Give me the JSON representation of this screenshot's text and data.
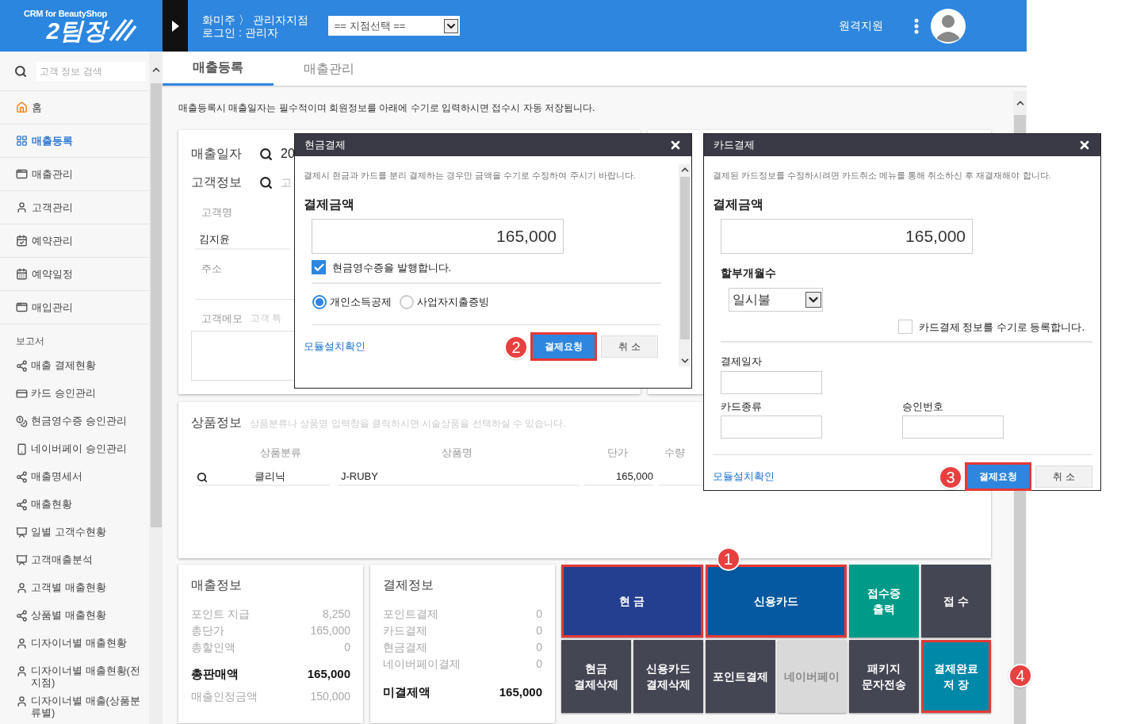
{
  "header": {
    "logo_small": "CRM for BeautyShop",
    "logo_big": "2팀장",
    "breadcrumb": "화미주 〉 관리자지점",
    "login": "로그인 : 관리자",
    "branch_select": "== 지점선택 ==",
    "remote_support": "원격지원"
  },
  "sidebar": {
    "search_placeholder": "고객 정보 검색",
    "items": [
      {
        "label": "홈",
        "kind": "home",
        "selected": false
      },
      {
        "label": "매출등록",
        "kind": "grid",
        "selected": true
      },
      {
        "label": "매출관리",
        "kind": "window",
        "selected": false
      },
      {
        "label": "고객관리",
        "kind": "person",
        "selected": false
      },
      {
        "label": "예약관리",
        "kind": "booking",
        "selected": false
      },
      {
        "label": "예약일정",
        "kind": "calendar",
        "selected": false
      },
      {
        "label": "매입관리",
        "kind": "window",
        "selected": false
      }
    ],
    "section": "보고서",
    "reports": [
      {
        "label": "매출 결제현황",
        "kind": "share"
      },
      {
        "label": "카드 승인관리",
        "kind": "card"
      },
      {
        "label": "현금영수증 승인관리",
        "kind": "cash"
      },
      {
        "label": "네이버페이 승인관리",
        "kind": "phone"
      },
      {
        "label": "매출명세서",
        "kind": "share"
      },
      {
        "label": "매출현황",
        "kind": "share"
      },
      {
        "label": "일별 고객수현황",
        "kind": "chart"
      },
      {
        "label": "고객매출분석",
        "kind": "chart"
      },
      {
        "label": "고객별 매출현황",
        "kind": "person"
      },
      {
        "label": "상품별 매출현황",
        "kind": "share"
      },
      {
        "label": "디자이너별 매출현황",
        "kind": "person"
      },
      {
        "label": "디자이너별 매출현황(전지점)",
        "kind": "person"
      },
      {
        "label": "디자이너별 매출(상품분류별)",
        "kind": "person"
      }
    ]
  },
  "tabs": [
    {
      "label": "매출등록",
      "selected": true
    },
    {
      "label": "매출관리",
      "selected": false
    }
  ],
  "notice": "매출등록시 매출일자는 필수적이며 회원정보를 아래에 수기로 입력하시면 접수시 자동 저장됩니다.",
  "sale_form": {
    "date_label": "매출일자",
    "date_value": "20",
    "customer_label": "고객정보",
    "customer_placeholder": "고",
    "name_label": "고객명",
    "name_value": "김지윤",
    "address_label": "주소",
    "memo_label": "고객메모",
    "memo_placeholder": "고객 특"
  },
  "product": {
    "title": "상품정보",
    "hint": "상품분류나 상품명 입력창을 클릭하시면 시술상품을 선택하실 수 있습니다.",
    "columns": [
      "상품분류",
      "상품명",
      "단가",
      "수량"
    ],
    "row": [
      "클리닉",
      "J-RUBY",
      "165,000"
    ]
  },
  "sales_info": {
    "title": "매출정보",
    "rows": [
      {
        "label": "포인트 지급",
        "value": "8,250"
      },
      {
        "label": "총단가",
        "value": "165,000"
      },
      {
        "label": "총할인액",
        "value": "0"
      }
    ],
    "total": {
      "label": "총판매액",
      "value": "165,000"
    },
    "approved": {
      "label": "매출인정금액",
      "value": "150,000"
    }
  },
  "payment_info": {
    "title": "결제정보",
    "rows": [
      {
        "label": "포인트결제",
        "value": "0"
      },
      {
        "label": "카드결제",
        "value": "0"
      },
      {
        "label": "현금결제",
        "value": "0"
      },
      {
        "label": "네이버페이결제",
        "value": "0"
      }
    ],
    "total": {
      "label": "미결제액",
      "value": "165,000"
    }
  },
  "pay_buttons": [
    {
      "kind": "main",
      "lines": [
        "현 금"
      ],
      "color": "#243f8f",
      "highlighted": true,
      "disabled": false,
      "badge": "1"
    },
    {
      "kind": "main",
      "lines": [
        "신용카드"
      ],
      "color": "#0559a0",
      "highlighted": true,
      "disabled": false
    },
    {
      "kind": "tile",
      "lines": [
        "접수증",
        "출력"
      ],
      "color": "#009b88",
      "highlighted": false,
      "disabled": false
    },
    {
      "kind": "tile",
      "lines": [
        "접 수"
      ],
      "color": "#454654",
      "highlighted": false,
      "disabled": false
    },
    {
      "kind": "tile",
      "lines": [
        "현금",
        "결제삭제"
      ],
      "color": "#454654",
      "highlighted": false,
      "disabled": false
    },
    {
      "kind": "tile",
      "lines": [
        "신용카드",
        "결제삭제"
      ],
      "color": "#454654",
      "highlighted": false,
      "disabled": false
    },
    {
      "kind": "tile",
      "lines": [
        "포인트결제"
      ],
      "color": "#454654",
      "highlighted": false,
      "disabled": false
    },
    {
      "kind": "tile",
      "lines": [
        "네이버페이"
      ],
      "color": "#d9d9d9",
      "highlighted": false,
      "disabled": true
    },
    {
      "kind": "tile",
      "lines": [
        "패키지",
        "문자전송"
      ],
      "color": "#454654",
      "highlighted": false,
      "disabled": false
    },
    {
      "kind": "tile",
      "lines": [
        "결제완료",
        "저 장"
      ],
      "color": "#0088a8",
      "highlighted": true,
      "disabled": false,
      "badge": "4"
    }
  ],
  "cash_dialog": {
    "title": "현금결제",
    "note": "결제시 현금과 카드를 분리 결제하는 경우만 금액을 수기로 수정하여 주시기 바랍니다.",
    "amount_label": "결제금액",
    "amount": "165,000",
    "receipt": {
      "label": "현금영수증을 발행합니다.",
      "checked": true
    },
    "radios": [
      {
        "label": "개인소득공제",
        "selected": true
      },
      {
        "label": "사업자지출증빙",
        "selected": false
      }
    ],
    "link": "모듈설치확인",
    "submit": {
      "label": "결제요청",
      "highlighted": true,
      "badge": "2"
    },
    "cancel": "취 소"
  },
  "card_dialog": {
    "title": "카드결제",
    "note": "결제된 카드정보를 수정하시려면 카드취소 메뉴를 통해 취소하신 후 재결재해야 합니다.",
    "amount_label": "결제금액",
    "amount": "165,000",
    "installment_label": "할부개월수",
    "installment": "일시불",
    "manual": {
      "label": "카드결제 정보를 수기로 등록합니다.",
      "checked": false
    },
    "date_label": "결제일자",
    "card_type_label": "카드종류",
    "approval_label": "승인번호",
    "link": "모듈설치확인",
    "submit": {
      "label": "결제요청",
      "highlighted": true,
      "badge": "3"
    },
    "cancel": "취 소"
  }
}
